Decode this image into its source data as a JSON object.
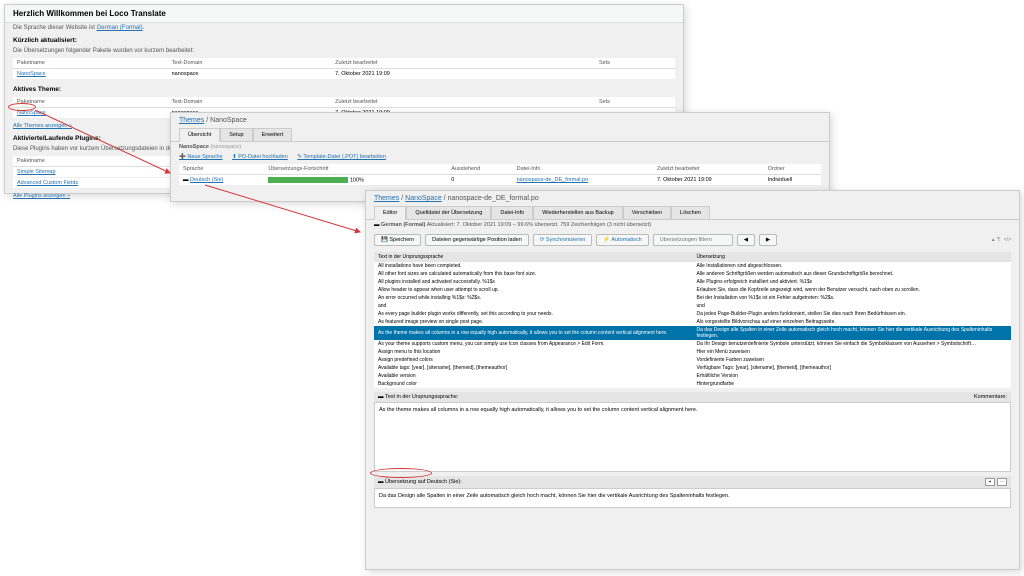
{
  "panel1": {
    "title": "Herzlich Willkommen bei Loco Translate",
    "subtitle_pre": "Die Sprache dieser Website ist ",
    "subtitle_link": "German (Formal)",
    "recent_label": "Kürzlich aktualisiert:",
    "recent_sub": "Die Übersetzungen folgender Pakete wurden vor kurzem bearbeitet:",
    "cols": [
      "Paketname",
      "Text-Domain",
      "Zuletzt bearbeitet",
      "Sets"
    ],
    "row": [
      "NanoSpace",
      "nanospace",
      "7. Oktober 2021 19:09",
      ""
    ],
    "active_label": "Aktives Theme:",
    "row2": [
      "NanoSpace",
      "nanospace",
      "7. Oktober 2021 19:09",
      ""
    ],
    "all_themes": "Alle Themes anzeigen »",
    "plugins_label": "Aktivierte/Laufende Plugins:",
    "plugins_sub": "Diese Plugins haben vor kurzem Übersetzungsdateien in den System-Bereich geladen:",
    "pcol": "Paketname",
    "p1": "Simple Sitemap",
    "p2": "Advanced Custom Fields",
    "all_plugins": "Alle Plugins anzeigen »"
  },
  "panel2": {
    "bc1": "Themes",
    "bc2": "NanoSpace",
    "tabs": [
      "Übersicht",
      "Setup",
      "Erweitert"
    ],
    "name": "NanoSpace",
    "domain": "(nanospace)",
    "a1": "Neue Sprache",
    "a2": "PO-Datei hochladen",
    "a3": "Template-Datei (.POT) bearbeiten",
    "cols": [
      "Sprache",
      "Übersetzungs-Fortschritt",
      "Ausstehend",
      "Datei-Info",
      "Zuletzt bearbeitet",
      "Ordner"
    ],
    "row": [
      "Deutsch (Sie)",
      "100%",
      "0",
      "nanospace-de_DE_formal.po",
      "7. Oktober 2021 19:09",
      "Individuell"
    ]
  },
  "panel3": {
    "bc1": "Themes",
    "bc2": "NanoSpace",
    "bc3": "nanospace-de_DE_formal.po",
    "tabs": [
      "Editor",
      "Quelldatei der Übersetzung",
      "Datei-Info",
      "Wiederherstellen aus Backup",
      "Verschieben",
      "Löschen"
    ],
    "status_lang": "German (Formal)",
    "status_text": "Aktualisiert: 7. Oktober 2021 19:09 – 99.6% übersetzt. 759 Zeichenfolgen (3 nicht übersetzt)",
    "btns": [
      "Speichern",
      "Dateien gegenwärtige Position laden",
      "Synchronisieren",
      "Automatisch"
    ],
    "filter_ph": "Übersetzungen filtern",
    "th1": "Text in der Ursprungssprache",
    "th2": "Übersetzung",
    "rows": [
      [
        "All installations have been completed.",
        "Alle Installationen sind abgeschlossen."
      ],
      [
        "All other font sizes are calculated automatically from this base font size.",
        "Alle anderen Schriftgrößen werden automatisch aus dieser Grundschriftgröße berechnet."
      ],
      [
        "All plugins installed and activated successfully. %1$s",
        "Alle Plugins erfolgreich installiert und aktiviert. %1$s"
      ],
      [
        "Allow header to appear when user attempt to scroll up.",
        "Erlauben Sie, dass die Kopfzeile angezeigt wird, wenn der Benutzer versucht, nach oben zu scrollen."
      ],
      [
        "An error occurred while installing %1$s: %2$s.",
        "Bei der Installation von %1$s ist ein Fehler aufgetreten: %2$s."
      ],
      [
        "and",
        "und"
      ],
      [
        "As every page builder plugin works differently, set this according to your needs.",
        "Da jedes Page-Builder-Plugin anders funktioniert, stellen Sie dies nach Ihren Bedürfnissen ein."
      ],
      [
        "As featured image preview on single post page.",
        "Als vorgestellte Bildvorschau auf einer einzelnen Beitragsseite."
      ],
      [
        "As the theme makes all columns in a row equally high automatically, it allows you to set the column content vertical alignment here.",
        "Da das Design alle Spalten in einer Zeile automatisch gleich hoch macht, können Sie hier die vertikale Ausrichtung des Spalteninhalts festlegen."
      ],
      [
        "As your theme supports custom menu, you can simply use Icon classes from Appearance > Edit Form.",
        "Da Ihr Design benutzerdefinierte Symbole unterstützt, können Sie einfach die Symbolklassen von Aussehen > Symbolschrift…"
      ],
      [
        "Assign menu to this location",
        "Hier ein Menü zuweisen"
      ],
      [
        "Assign predefined colors",
        "Vordefinierte Farben zuweisen"
      ],
      [
        "Available tags: [year], [sitename], [themeid], [themeauthor]",
        "Verfügbare Tags: [year], [sitename], [themeid], [themeauthor]"
      ],
      [
        "Available version",
        "Erhältliche Version"
      ],
      [
        "Background color",
        "Hintergrundfarbe"
      ]
    ],
    "src_label": "Text in der Ursprungssprache:",
    "src_text": "As the theme makes all columns in a row equally high automatically, it allows you to set the column content vertical alignment here.",
    "tgt_label": "Übersetzung auf Deutsch (Sie):",
    "tgt_text": "Da das Design alle Spalten in einer Zeile automatisch gleich hoch macht, können Sie hier die vertikale Ausrichtung des Spalteninhalts festlegen.",
    "comment_label": "Kommentare:"
  }
}
